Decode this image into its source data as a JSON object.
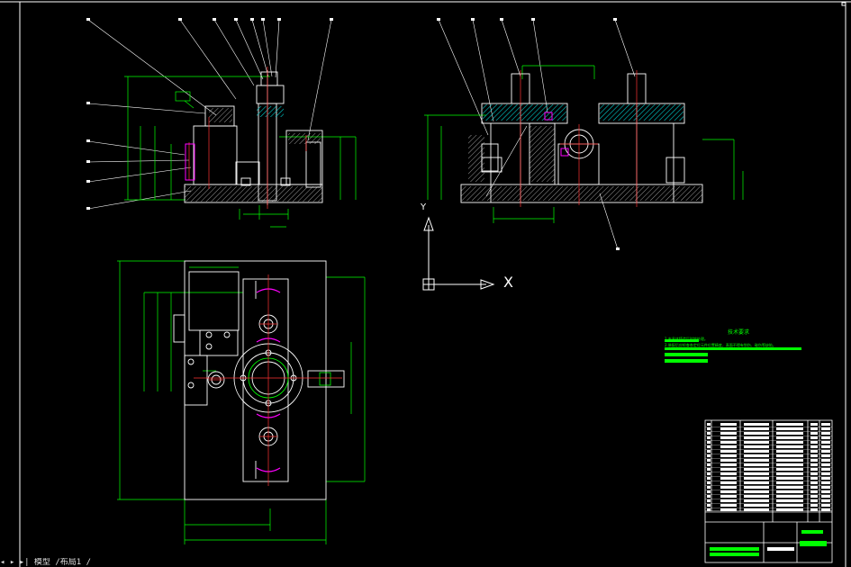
{
  "statusbar": {
    "text": "◂ ▸ ▸| 模型 /布局1 /"
  },
  "ucs": {
    "x_label": "X",
    "y_label": "Y"
  },
  "notes": {
    "title": "技术要求",
    "lines": [
      "1.夹具体铸造后时效处理。",
      "2.装配后应检查各定位元件位置精度，表面不得有划伤、碰伤等缺陷。"
    ]
  },
  "colors": {
    "background": "#000000",
    "outline": "#ffffff",
    "dimension": "#00ff00",
    "hatch": "#00cccc",
    "center": "#ff3333",
    "magenta": "#ff00ff"
  }
}
